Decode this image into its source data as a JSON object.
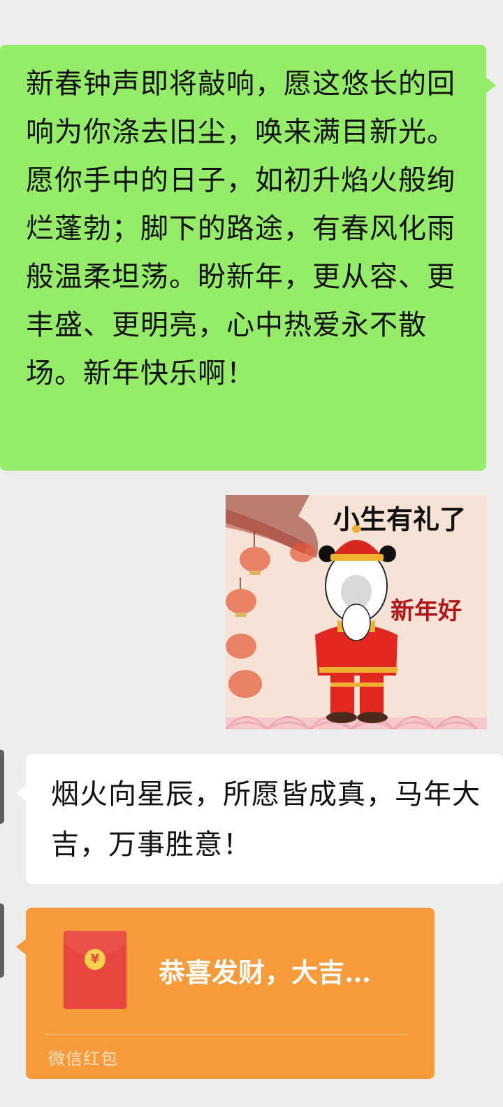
{
  "messages": {
    "sent_text": "新春钟声即将敲响，愿这悠长的回响为你涤去旧尘，唤来满目新光。愿你手中的日子，如初升焰火般绚烂蓬勃；脚下的路途，有春风化雨般温柔坦荡。盼新年，更从容、更丰盛、更明亮，心中热爱永不散场。新年快乐啊！",
    "sticker": {
      "caption_top": "小生有礼了",
      "caption_side": "新年好"
    },
    "received_text": "烟火向星辰，所愿皆成真，马年大吉，万事胜意！",
    "red_packet": {
      "coin_symbol": "¥",
      "title": "恭喜发财，大吉…",
      "label": "微信红包"
    }
  },
  "colors": {
    "background": "#ededed",
    "sent_bubble": "#95ec69",
    "received_bubble": "#ffffff",
    "red_packet": "#f79b3a",
    "envelope": "#e8473f"
  }
}
